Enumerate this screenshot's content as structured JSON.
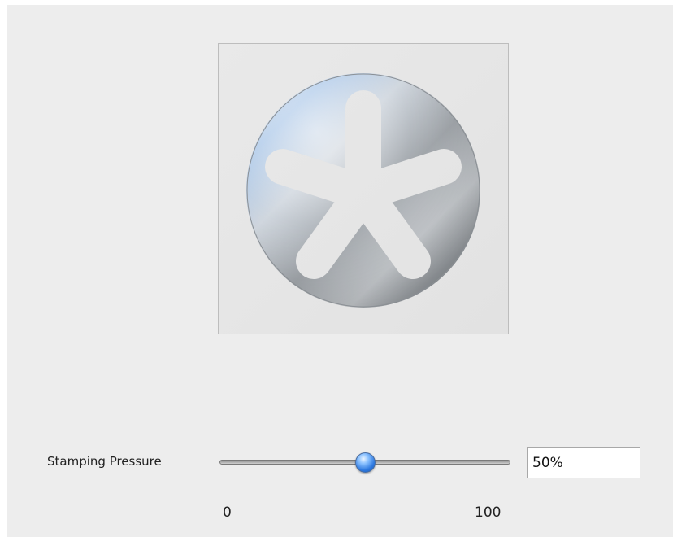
{
  "preview": {
    "image_description_icon": "stamped-metal-disc-asterisk-icon"
  },
  "pressure": {
    "label": "Stamping Pressure",
    "value": 0.5,
    "value_text": "50%",
    "min_label": "0",
    "max_label": "100"
  },
  "colors": {
    "background": "#ededed",
    "slider_thumb": "#2f7ae0"
  }
}
